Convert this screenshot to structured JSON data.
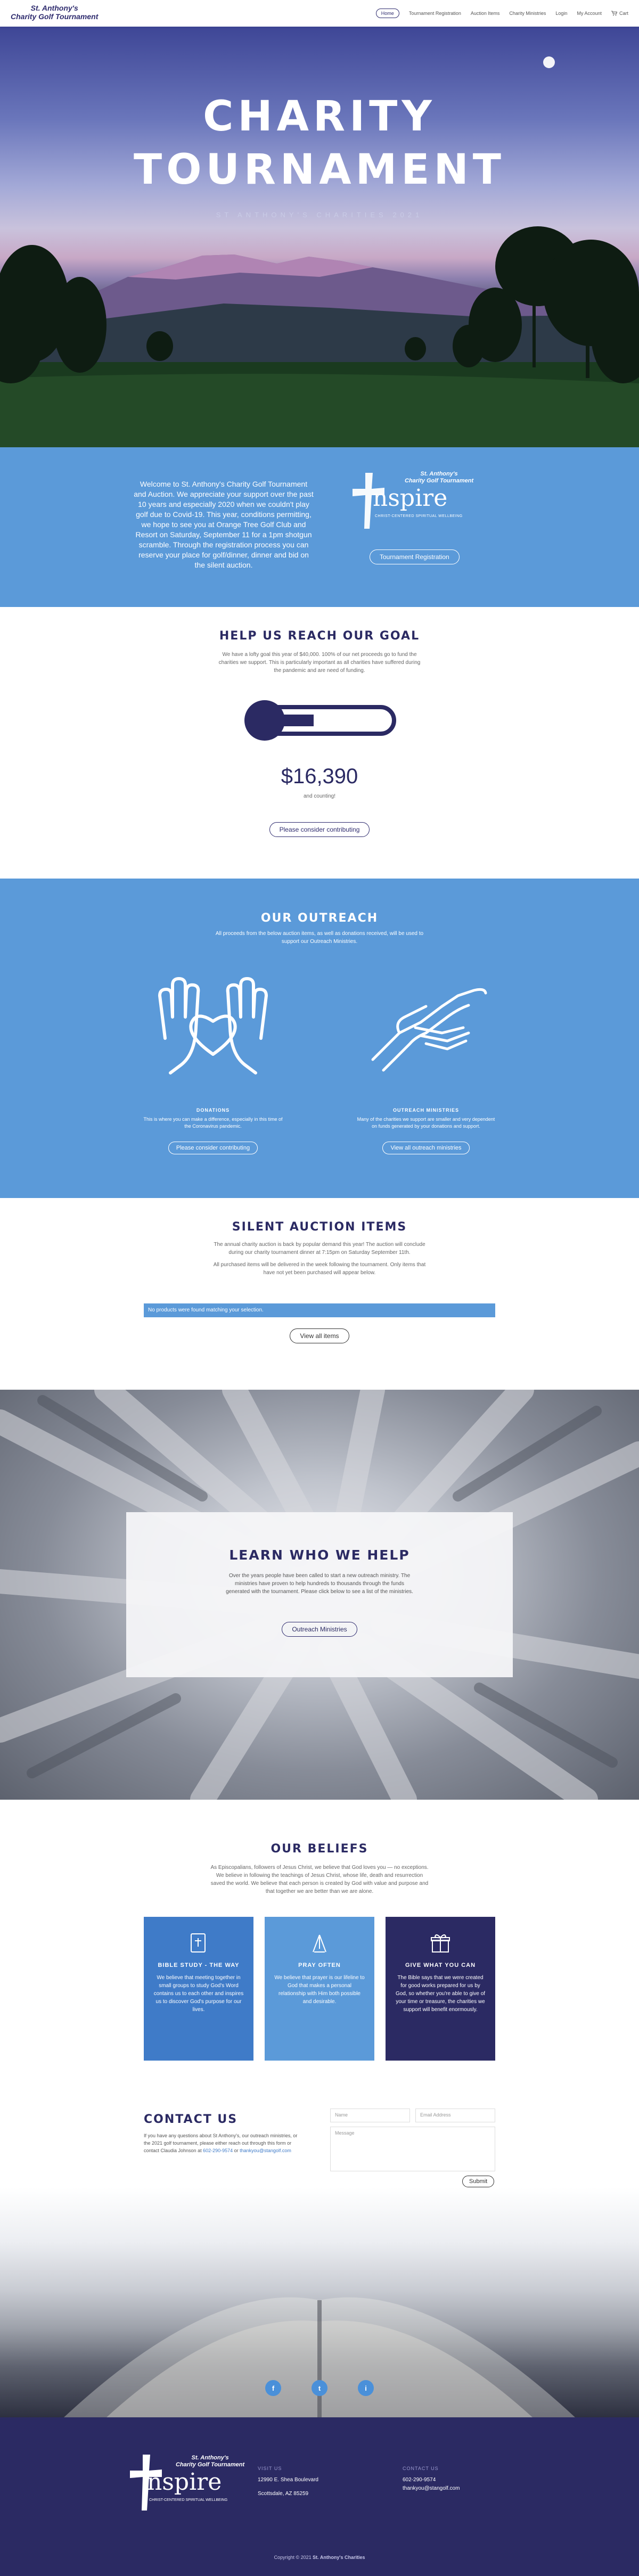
{
  "header": {
    "logo_line1": "St. Anthony's",
    "logo_line2": "Charity Golf Tournament",
    "nav": [
      "Home",
      "Tournament Registration",
      "Auction Items",
      "Charity Ministries",
      "Login",
      "My Account"
    ],
    "cart_label": "Cart"
  },
  "hero": {
    "title_line1": "CHARITY",
    "title_line2": "TOURNAMENT",
    "subtitle": "ST ANTHONY'S CHARITIES 2021"
  },
  "welcome": {
    "text": "Welcome to St. Anthony's Charity Golf Tournament and Auction. We appreciate your support over the past 10 years and especially 2020 when we couldn't play golf due to Covid-19. This year, conditions permitting, we hope to see you at Orange Tree Golf Club and Resort on Saturday, September 11 for a 1pm shotgun scramble. Through the registration process you can reserve your place for golf/dinner, dinner and bid on the silent auction.",
    "badge_line1": "St. Anthony's",
    "badge_line2": "Charity Golf Tournament",
    "badge_word": "nspire",
    "badge_tag": "CHRIST-CENTERED SPIRITUAL WELLBEING",
    "button": "Tournament Registration"
  },
  "goal": {
    "title": "HELP US REACH OUR GOAL",
    "text": "We have a lofty goal this year of $40,000.  100% of our net proceeds go to fund the charities we support.  This is particularly important as all charities have suffered during the pandemic and are need of funding.",
    "progress_fraction": 0.41,
    "amount": "$16,390",
    "counting": "and counting!",
    "button": "Please consider contributing"
  },
  "outreach": {
    "title": "OUR OUTREACH",
    "intro": "All proceeds from the below auction items, as well as donations received, will be used to support our Outreach Ministries.",
    "donations": {
      "title": "DONATIONS",
      "text": "This is where you can make a difference, especially in this time of the Coronavirus pandemic.",
      "button": "Please consider contributing"
    },
    "ministries": {
      "title": "OUTREACH MINISTRIES",
      "text": "Many of the charities we support are smaller and very dependent on funds generated by your donations and support.",
      "button": "View all outreach ministries"
    }
  },
  "auction": {
    "title": "SILENT AUCTION ITEMS",
    "text1": "The annual charity auction is back by popular demand this year! The auction will conclude during our charity tournament dinner at 7:15pm on Saturday September 11th.",
    "text2": "All purchased items will be delivered in the week following the tournament. Only items that have not yet been purchased will appear below.",
    "notice": "No products were found matching your selection.",
    "button": "View all items"
  },
  "learn": {
    "title": "LEARN WHO WE HELP",
    "text": "Over the years people have been called to start a new outreach ministry. The ministries have proven to help hundreds to thousands through the funds generated with the tournament. Please click below to see a list of the ministries.",
    "button": "Outreach Ministries"
  },
  "beliefs": {
    "title": "OUR BELIEFS",
    "text": "As Episcopalians, followers of Jesus Christ, we believe that God loves you — no exceptions. We believe in following the teachings of Jesus Christ, whose life, death and resurrection saved the world. We believe that each person is created by God with value and purpose and that together we are better than we are alone.",
    "cards": [
      {
        "title": "BIBLE STUDY - THE WAY",
        "text": "We believe that meeting together in small groups to study God's Word contains us to each other and inspires us to discover God's purpose for our lives.",
        "color": "#3f7bc8",
        "icon": "bible-icon"
      },
      {
        "title": "PRAY OFTEN",
        "text": "We believe that prayer is our lifeline to God that makes a personal relationship with Him both possible and desirable.",
        "color": "#5b9ad9",
        "icon": "praying-hands-icon"
      },
      {
        "title": "GIVE WHAT YOU CAN",
        "text": "The Bible says that we were created for good works prepared for us by God, so whether you're able to give of your time or treasure, the charities we support will benefit enormously.",
        "color": "#2b2a63",
        "icon": "gift-icon"
      }
    ]
  },
  "contact": {
    "title": "CONTACT US",
    "text_before": "If you have any questions about St Anthony's, our outreach ministries, or the 2021 golf tournament, please either reach out through this form or contact Claudia Johnson at ",
    "phone": "602-290-9574",
    "text_mid": " or ",
    "email": "thankyou@stangolf.com",
    "name_placeholder": "Name",
    "email_placeholder": "Email Address",
    "message_placeholder": "Message",
    "submit": "Submit",
    "social": [
      "f",
      "t",
      "i"
    ]
  },
  "footer": {
    "visit_heading": "VISIT US",
    "address1": "12990 E. Shea Boulevard",
    "address2": "Scottsdale, AZ 85259",
    "contact_heading": "CONTACT US",
    "phone": "602-290-9574",
    "email": "thankyou@stangolf.com",
    "copyright_prefix": "Copyright © 2021 ",
    "copyright_name": "St. Anthony's Charities"
  }
}
